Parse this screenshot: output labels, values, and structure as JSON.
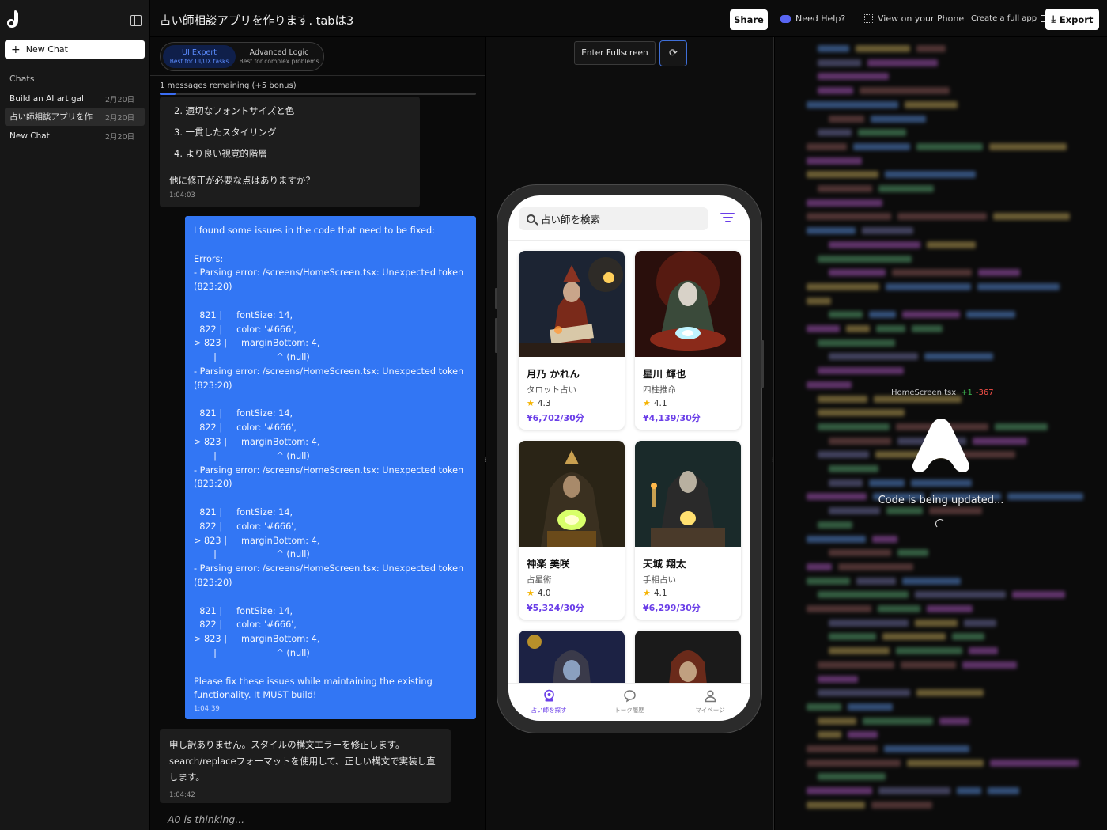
{
  "sidebar": {
    "new_chat": "New Chat",
    "chats_heading": "Chats",
    "items": [
      {
        "title": "Build an AI art gall",
        "date": "2月20日"
      },
      {
        "title": "占い師相談アプリを作",
        "date": "2月20日"
      },
      {
        "title": "New Chat",
        "date": "2月20日"
      }
    ]
  },
  "header": {
    "title": "占い師相談アプリを作ります. tabは3",
    "share": "Share",
    "need_help": "Need Help?",
    "view_phone": "View on your Phone",
    "create_full_app": "Create a full app",
    "export": "Export"
  },
  "chat": {
    "modes": [
      {
        "name": "UI Expert",
        "sub": "Best for UI/UX tasks",
        "active": true
      },
      {
        "name": "Advanced Logic",
        "sub": "Best for complex problems",
        "active": false
      }
    ],
    "remaining": "1 messages remaining (+5 bonus)",
    "quota_fraction": 0.05,
    "msg1": {
      "items": [
        "2.  適切なフォントサイズと色",
        "3.  一貫したスタイリング",
        "4.  より良い視覚的階層"
      ],
      "question": "他に修正が必要な点はありますか？",
      "time": "1:04:03"
    },
    "user_msg": {
      "text": "I found some issues in the code that need to be fixed:\n\nErrors:\n- Parsing error: /screens/HomeScreen.tsx: Unexpected token (823:20)\n\n  821 |     fontSize: 14,\n  822 |     color: '#666',\n> 823 |     marginBottom: 4,\n       |                     ^ (null)\n- Parsing error: /screens/HomeScreen.tsx: Unexpected token (823:20)\n\n  821 |     fontSize: 14,\n  822 |     color: '#666',\n> 823 |     marginBottom: 4,\n       |                     ^ (null)\n- Parsing error: /screens/HomeScreen.tsx: Unexpected token (823:20)\n\n  821 |     fontSize: 14,\n  822 |     color: '#666',\n> 823 |     marginBottom: 4,\n       |                     ^ (null)\n- Parsing error: /screens/HomeScreen.tsx: Unexpected token (823:20)\n\n  821 |     fontSize: 14,\n  822 |     color: '#666',\n> 823 |     marginBottom: 4,\n       |                     ^ (null)\n\nPlease fix these issues while maintaining the existing functionality. It MUST build!",
      "time": "1:04:39"
    },
    "msg3": {
      "text": "申し訳ありません。スタイルの構文エラーを修正します。search/replaceフォーマットを使用して、正しい構文で実装し直します。",
      "time": "1:04:42"
    },
    "thinking": "A0 is thinking..."
  },
  "preview": {
    "fullscreen": "Enter Fullscreen",
    "search_placeholder": "占い師を検索",
    "cards": [
      {
        "name": "月乃 かれん",
        "specialty": "タロット占い",
        "rating": "4.3",
        "price": "¥6,702/30分"
      },
      {
        "name": "星川 輝也",
        "specialty": "四柱推命",
        "rating": "4.1",
        "price": "¥4,139/30分"
      },
      {
        "name": "神楽 美咲",
        "specialty": "占星術",
        "rating": "4.0",
        "price": "¥5,324/30分"
      },
      {
        "name": "天城 翔太",
        "specialty": "手相占い",
        "rating": "4.1",
        "price": "¥6,299/30分"
      }
    ],
    "tabs": [
      "占い師を探す",
      "トーク履歴",
      "マイページ"
    ],
    "accent": "#6a3ee8"
  },
  "code": {
    "file": "HomeScreen.tsx",
    "added": "+1",
    "removed": "-367",
    "status": "Code is being updated..."
  }
}
